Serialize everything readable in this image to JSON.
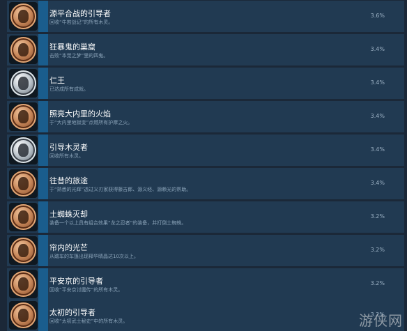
{
  "achievements": [
    {
      "title": "源平合战的引导者",
      "desc": "回收“牛若战记”的所有木灵。",
      "pct": "3.6%",
      "medal": "bronze"
    },
    {
      "title": "狂暴鬼的巢窟",
      "desc": "击败“本觉之梦”里的四鬼。",
      "pct": "3.4%",
      "medal": "bronze"
    },
    {
      "title": "仁王",
      "desc": "已达成所有成就。",
      "pct": "3.4%",
      "medal": "silver"
    },
    {
      "title": "照亮大内里的火焰",
      "desc": "于“大内里地狱变”点燃所有护摩之火。",
      "pct": "3.4%",
      "medal": "bronze"
    },
    {
      "title": "引导木灵者",
      "desc": "回收所有木灵。",
      "pct": "3.4%",
      "medal": "silver"
    },
    {
      "title": "往昔的旅途",
      "desc": "于“熟悉的光辉”透过义刃家获得藤吉郎、源义经、源赖光的帮助。",
      "pct": "3.4%",
      "medal": "bronze"
    },
    {
      "title": "土蜘蛛灭却",
      "desc": "装备一个以上具有组合效果“龙之忍者”的装备，并打倒土蜘蛛。",
      "pct": "3.2%",
      "medal": "bronze"
    },
    {
      "title": "帘内的光芒",
      "desc": "从踏车的车篷出现释华晴晶达10次以上。",
      "pct": "3.2%",
      "medal": "bronze"
    },
    {
      "title": "平安京的引导者",
      "desc": "回收“平安京讨魔传”的所有木灵。",
      "pct": "3.2%",
      "medal": "bronze"
    },
    {
      "title": "太初的引导者",
      "desc": "回收“太初武士秘史”中的所有木灵。",
      "pct": "3.2%",
      "medal": "bronze"
    }
  ],
  "watermark": "游侠网"
}
